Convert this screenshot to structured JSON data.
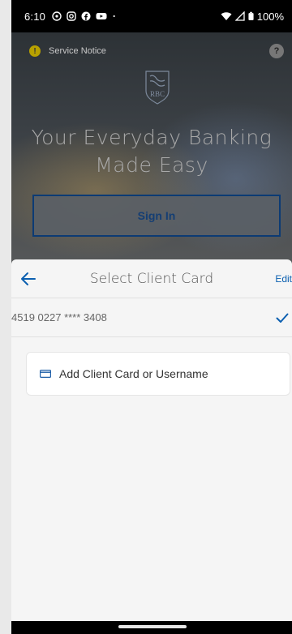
{
  "status_bar": {
    "time": "6:10",
    "battery": "100%",
    "app_icons": [
      "whatsapp-icon",
      "instagram-icon",
      "facebook-icon",
      "youtube-icon"
    ]
  },
  "banner": {
    "notice_label": "Service Notice",
    "notice_badge": "!",
    "help_badge": "?"
  },
  "hero": {
    "brand": "RBC",
    "headline_line1": "Your Everyday Banking",
    "headline_line2": "Made Easy",
    "signin_label": "Sign In"
  },
  "sheet": {
    "title": "Select Client Card",
    "edit_label": "Edit",
    "selected_card": "4519 0227 **** 3408",
    "add_card_label": "Add Client Card or Username"
  },
  "colors": {
    "accent": "#0b5fb0",
    "signin_border": "#0c3b74",
    "sheet_bg": "#f5f5f5"
  }
}
